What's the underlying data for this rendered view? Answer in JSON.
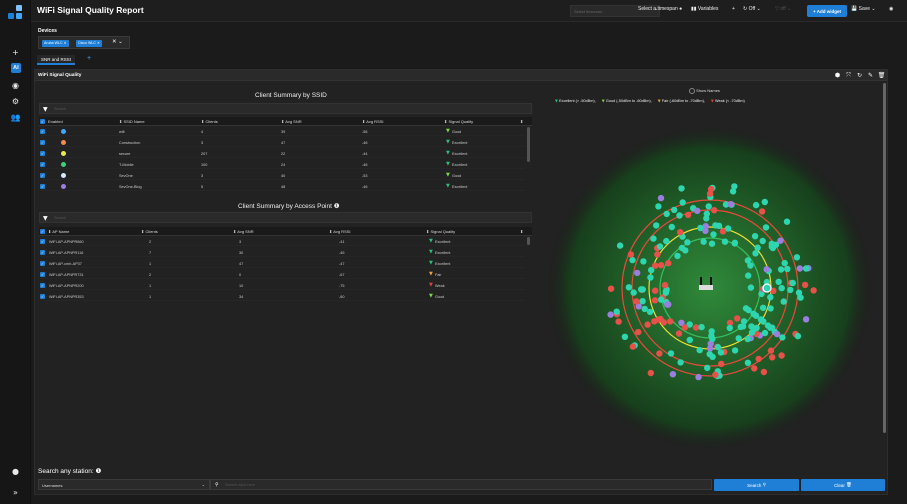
{
  "app": {
    "title": "WiFi Signal Quality Report"
  },
  "topbar": {
    "timespan_placeholder": "Select timezone",
    "timespan_label": "Select a timespan",
    "variables_label": "Variables",
    "refresh_label": "Off",
    "add_widget_label": "+ Add widget",
    "save_label": "Save"
  },
  "devices": {
    "label": "Devices",
    "chips": [
      "Aruba WLC",
      "Cisco WLC"
    ]
  },
  "tabs": [
    {
      "label": "SNR and RSSI"
    }
  ],
  "panel": {
    "title": "WiFi Signal Quality"
  },
  "ssid_table": {
    "title": "Client Summary by SSID",
    "search_placeholder": "Search",
    "headers": [
      "Enabled",
      "SSID Name",
      "Clients",
      "Avg SNR",
      "Avg RSSI",
      "Signal Quality"
    ],
    "rows": [
      {
        "color": "#3da8ff",
        "name": "wifi",
        "clients": "4",
        "snr": "39",
        "rssi": "-56",
        "quality": "Good",
        "q_color": "#7fd84a"
      },
      {
        "color": "#f58a4a",
        "name": "Construction",
        "clients": "3",
        "snr": "47",
        "rssi": "-46",
        "quality": "Excellent",
        "q_color": "#2ebd7a"
      },
      {
        "color": "#e8e850",
        "name": "secure",
        "clients": "207",
        "snr": "22",
        "rssi": "-44",
        "quality": "Excellent",
        "q_color": "#2ebd7a"
      },
      {
        "color": "#3ad17a",
        "name": "T-Mobile",
        "clients": "100",
        "snr": "24",
        "rssi": "-46",
        "quality": "Excellent",
        "q_color": "#2ebd7a"
      },
      {
        "color": "#d8e8ff",
        "name": "SevOne",
        "clients": "3",
        "snr": "40",
        "rssi": "-53",
        "quality": "Good",
        "q_color": "#7fd84a"
      },
      {
        "color": "#9a7fe0",
        "name": "SevOne-Blog",
        "clients": "5",
        "snr": "48",
        "rssi": "-46",
        "quality": "Excellent",
        "q_color": "#2ebd7a"
      }
    ]
  },
  "ap_table": {
    "title": "Client Summary by Access Point",
    "search_placeholder": "Search",
    "headers": [
      "AP Name",
      "Clients",
      "Avg SNR",
      "Avg RSSI",
      "Signal Quality"
    ],
    "rows": [
      {
        "name": "WiFi-AP-APNPR660",
        "clients": "2",
        "snr": "3",
        "rssi": "-41",
        "quality": "Excellent",
        "q_color": "#2ebd7a"
      },
      {
        "name": "WiFi-AP-APNPR116",
        "clients": "7",
        "snr": "30",
        "rssi": "-45",
        "quality": "Excellent",
        "q_color": "#2ebd7a"
      },
      {
        "name": "WiFi-AP-cmh-AP37",
        "clients": "1",
        "snr": "47",
        "rssi": "-47",
        "quality": "Excellent",
        "q_color": "#2ebd7a"
      },
      {
        "name": "WiFi-AP-APNPR731",
        "clients": "2",
        "snr": "0",
        "rssi": "-67",
        "quality": "Fair",
        "q_color": "#f0a040"
      },
      {
        "name": "WiFi-AP-APNPR200",
        "clients": "1",
        "snr": "10",
        "rssi": "-75",
        "quality": "Weak",
        "q_color": "#e04040"
      },
      {
        "name": "WiFi-AP-APNPR353",
        "clients": "1",
        "snr": "34",
        "rssi": "-60",
        "quality": "Good",
        "q_color": "#7fd84a"
      }
    ]
  },
  "radar": {
    "show_names_label": "Show Names",
    "legend": [
      {
        "label": "Excellent (> -50dBm),",
        "color": "#2ebd7a"
      },
      {
        "label": "Good (-50dBm to -60dBm),",
        "color": "#7fd84a"
      },
      {
        "label": "Fair (-60dBm to -70dBm),",
        "color": "#f0a040"
      },
      {
        "label": "Weak (< -70dBm)",
        "color": "#e04040"
      }
    ]
  },
  "station_search": {
    "label": "Search any station:",
    "type_value": "Usernames",
    "input_placeholder": "Search input here",
    "search_label": "Search",
    "clear_label": "Clear"
  }
}
